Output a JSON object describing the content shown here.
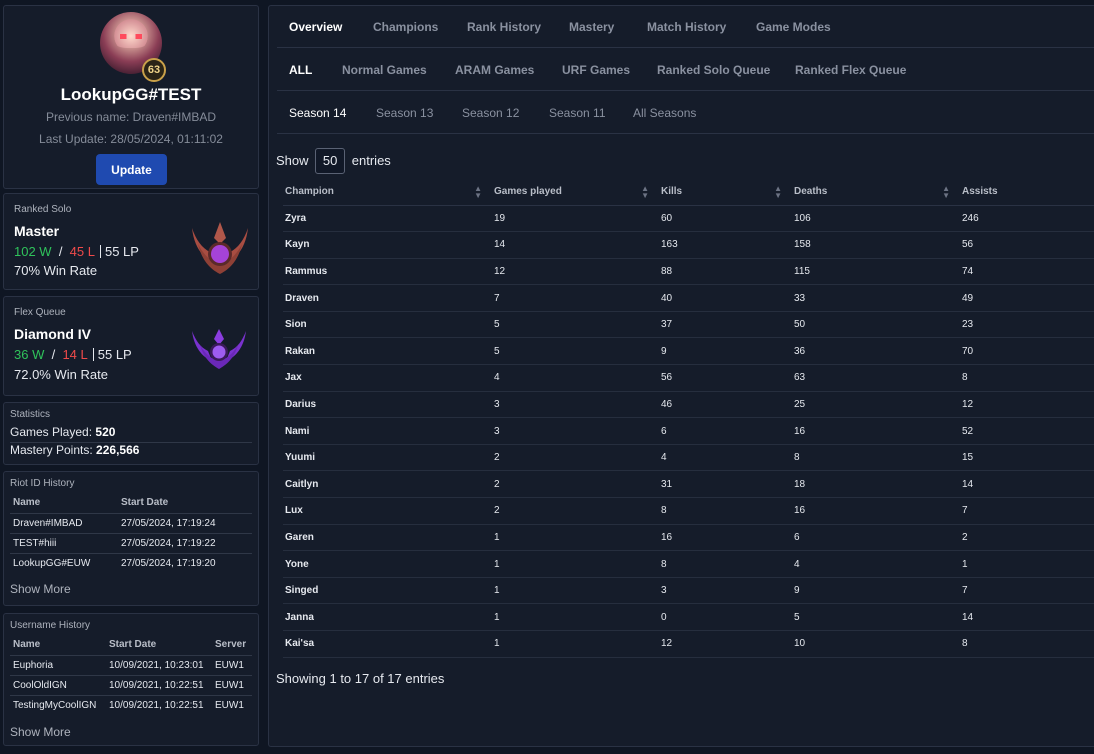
{
  "profile": {
    "summoner_name": "LookupGG#TEST",
    "level": "63",
    "previous_name": "Previous name:  Draven#IMBAD",
    "last_update": "Last Update:  28/05/2024, 01:11:02",
    "update_label": "Update"
  },
  "ranked_solo": {
    "label": "Ranked Solo",
    "tier": "Master",
    "wins": "102 W",
    "losses": "45 L",
    "lp": "55 LP",
    "win_rate": "70% Win Rate",
    "emblem_color": "#b0574a"
  },
  "flex_queue": {
    "label": "Flex Queue",
    "tier": "Diamond IV",
    "wins": "36 W",
    "losses": "14 L",
    "lp": "55 LP",
    "win_rate": "72.0% Win Rate",
    "emblem_color": "#8b3de0"
  },
  "statistics": {
    "label": "Statistics",
    "games_played_label": "Games Played:",
    "games_played": "520",
    "mastery_label": "Mastery Points:",
    "mastery_points": "226,566"
  },
  "riot_id_history": {
    "label": "Riot ID History",
    "headers": [
      "Name",
      "Start Date"
    ],
    "rows": [
      [
        "Draven#IMBAD",
        "27/05/2024, 17:19:24"
      ],
      [
        "TEST#hiii",
        "27/05/2024, 17:19:22"
      ],
      [
        "LookupGG#EUW",
        "27/05/2024, 17:19:20"
      ]
    ],
    "show_more": "Show More"
  },
  "username_history": {
    "label": "Username History",
    "headers": [
      "Name",
      "Start Date",
      "Server"
    ],
    "rows": [
      [
        "Euphoria",
        "10/09/2021, 10:23:01",
        "EUW1"
      ],
      [
        "CoolOldIGN",
        "10/09/2021, 10:22:51",
        "EUW1"
      ],
      [
        "TestingMyCoolIGN",
        "10/09/2021, 10:22:51",
        "EUW1"
      ]
    ],
    "show_more": "Show More"
  },
  "tabs": {
    "main": [
      "Overview",
      "Champions",
      "Rank History",
      "Mastery",
      "Match History",
      "Game Modes"
    ],
    "queue": [
      "ALL",
      "Normal Games",
      "ARAM Games",
      "URF Games",
      "Ranked Solo Queue",
      "Ranked Flex Queue"
    ],
    "season": [
      "Season 14",
      "Season 13",
      "Season 12",
      "Season 11",
      "All Seasons"
    ]
  },
  "table": {
    "show_label": "Show",
    "entries_value": "50",
    "entries_label": "entries",
    "headers": [
      "Champion",
      "Games played",
      "Kills",
      "Deaths",
      "Assists"
    ],
    "rows": [
      [
        "Zyra",
        "19",
        "60",
        "106",
        "246"
      ],
      [
        "Kayn",
        "14",
        "163",
        "158",
        "56"
      ],
      [
        "Rammus",
        "12",
        "88",
        "115",
        "74"
      ],
      [
        "Draven",
        "7",
        "40",
        "33",
        "49"
      ],
      [
        "Sion",
        "5",
        "37",
        "50",
        "23"
      ],
      [
        "Rakan",
        "5",
        "9",
        "36",
        "70"
      ],
      [
        "Jax",
        "4",
        "56",
        "63",
        "8"
      ],
      [
        "Darius",
        "3",
        "46",
        "25",
        "12"
      ],
      [
        "Nami",
        "3",
        "6",
        "16",
        "52"
      ],
      [
        "Yuumi",
        "2",
        "4",
        "8",
        "15"
      ],
      [
        "Caitlyn",
        "2",
        "31",
        "18",
        "14"
      ],
      [
        "Lux",
        "2",
        "8",
        "16",
        "7"
      ],
      [
        "Garen",
        "1",
        "16",
        "6",
        "2"
      ],
      [
        "Yone",
        "1",
        "8",
        "4",
        "1"
      ],
      [
        "Singed",
        "1",
        "3",
        "9",
        "7"
      ],
      [
        "Janna",
        "1",
        "0",
        "5",
        "14"
      ],
      [
        "Kai'sa",
        "1",
        "12",
        "10",
        "8"
      ]
    ],
    "footer": "Showing 1 to 17 of 17 entries"
  }
}
